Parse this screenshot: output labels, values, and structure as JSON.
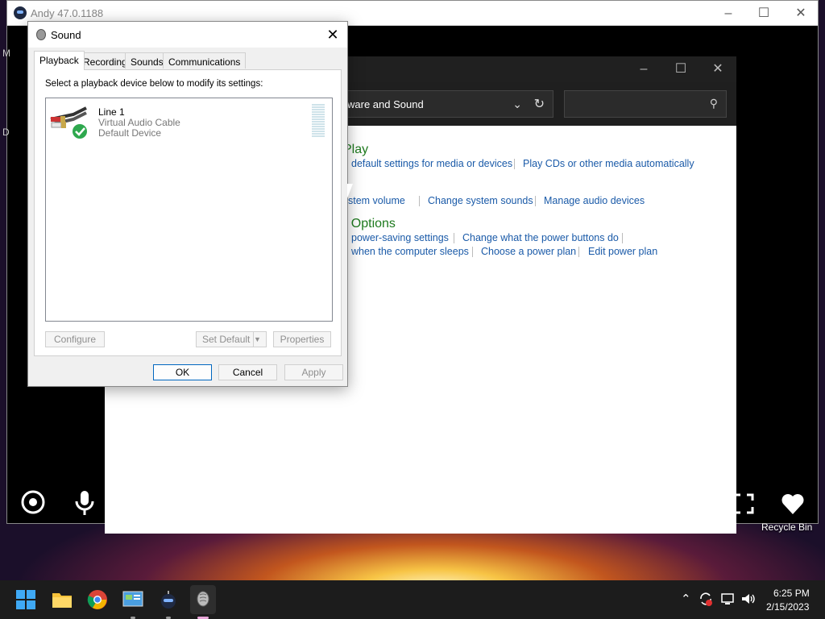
{
  "andy": {
    "title": "Andy 47.0.1188"
  },
  "control_panel": {
    "address": "ware and Sound",
    "heading_autoplay": "Play",
    "heading_power": "r Options",
    "links_row1": [
      "default settings for media or devices",
      "Play CDs or other media automatically"
    ],
    "links_row2": [
      "stem volume",
      "Change system sounds",
      "Manage audio devices"
    ],
    "links_row3": [
      "power-saving settings",
      "Change what the power buttons do"
    ],
    "links_row4": [
      "when the computer sleeps",
      "Choose a power plan",
      "Edit power plan"
    ]
  },
  "sound_dialog": {
    "title": "Sound",
    "tabs": [
      "Playback",
      "Recording",
      "Sounds",
      "Communications"
    ],
    "active_tab": "Playback",
    "instruction": "Select a playback device below to modify its settings:",
    "device": {
      "name": "Line 1",
      "description": "Virtual Audio Cable",
      "status": "Default Device"
    },
    "buttons": {
      "configure": "Configure",
      "set_default": "Set Default",
      "properties": "Properties",
      "ok": "OK",
      "cancel": "Cancel",
      "apply": "Apply"
    }
  },
  "desktop": {
    "recycle_bin": "Recycle Bin"
  },
  "taskbar": {
    "time": "6:25 PM",
    "date": "2/15/2023",
    "apps": [
      "start-icon",
      "file-explorer-icon",
      "chrome-icon",
      "control-panel-icon",
      "andy-icon",
      "sound-icon"
    ]
  },
  "colors": {
    "cp_link": "#1a5aa8",
    "cp_heading": "#1e7a1e",
    "taskbar": "#1c1c1c",
    "dialog_primary_border": "#0067c0"
  }
}
